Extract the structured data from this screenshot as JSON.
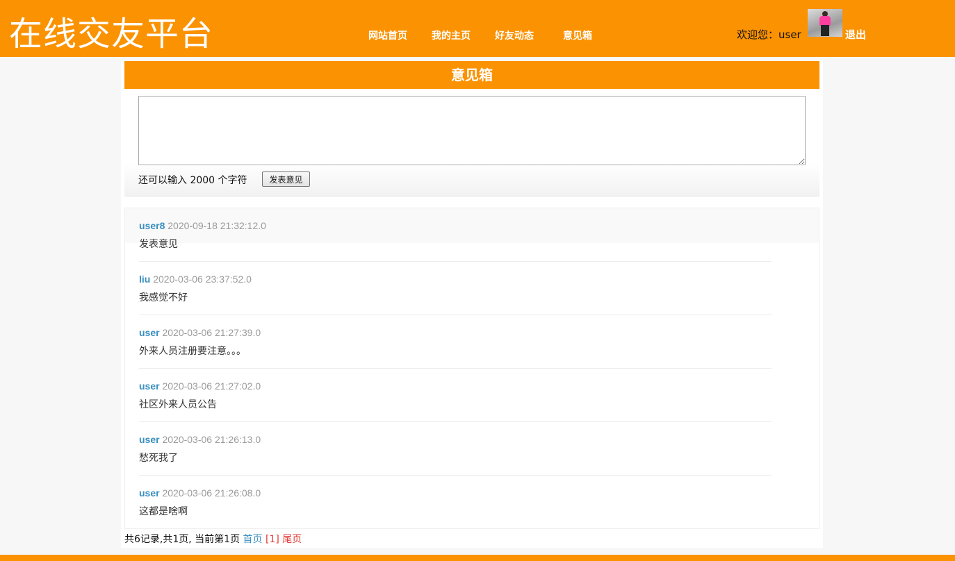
{
  "header": {
    "logo": "在线交友平台",
    "nav": [
      "网站首页",
      "我的主页",
      "好友动态",
      "意见箱"
    ],
    "welcome": "欢迎您：user",
    "logout": "退出"
  },
  "feedback": {
    "title": "意见箱",
    "counter_text": "还可以输入 2000 个字符",
    "submit_label": "发表意见",
    "textarea_value": ""
  },
  "entries": [
    {
      "user": "user8",
      "time": "2020-09-18 21:32:12.0",
      "message": "发表意见"
    },
    {
      "user": "liu",
      "time": "2020-03-06 23:37:52.0",
      "message": "我感觉不好"
    },
    {
      "user": "user",
      "time": "2020-03-06 21:27:39.0",
      "message": "外来人员注册要注意。。。"
    },
    {
      "user": "user",
      "time": "2020-03-06 21:27:02.0",
      "message": "社区外来人员公告"
    },
    {
      "user": "user",
      "time": "2020-03-06 21:26:13.0",
      "message": "愁死我了"
    },
    {
      "user": "user",
      "time": "2020-03-06 21:26:08.0",
      "message": "这都是啥啊"
    }
  ],
  "pager": {
    "summary": "共6记录,共1页, 当前第1页 ",
    "first": "首页",
    "current": "[1]",
    "last": "尾页"
  },
  "colors": {
    "accent": "#fb9202",
    "link": "#3a8fc0",
    "pager_red": "#e53935"
  }
}
